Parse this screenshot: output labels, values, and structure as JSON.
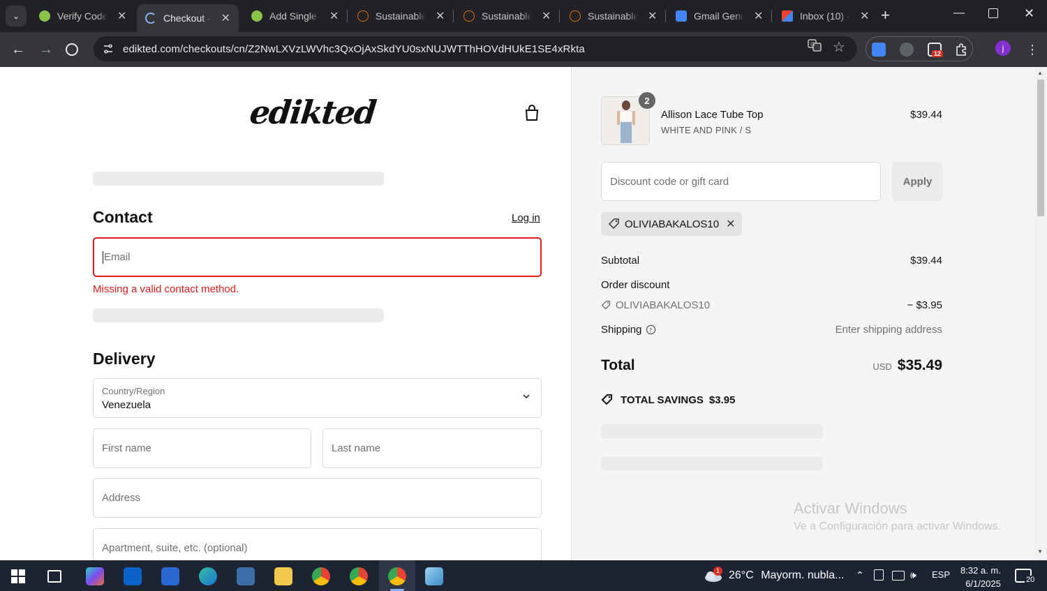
{
  "browser": {
    "tabs": [
      {
        "title": "Verify Codes",
        "active": false,
        "favicon_color": "#8bc34a"
      },
      {
        "title": "Checkout - e",
        "active": true,
        "favicon_color": "#8ab4f8"
      },
      {
        "title": "Add Single-",
        "active": false,
        "favicon_color": "#8bc34a"
      },
      {
        "title": "Sustainable",
        "active": false,
        "favicon_color": "#e8710a"
      },
      {
        "title": "Sustainable",
        "active": false,
        "favicon_color": "#e8710a"
      },
      {
        "title": "Sustainable",
        "active": false,
        "favicon_color": "#e8710a"
      },
      {
        "title": "Gmail Gener",
        "active": false,
        "favicon_color": "#4285f4"
      },
      {
        "title": "Inbox (10) -",
        "active": false,
        "favicon_color": "#ea4335"
      }
    ],
    "url": "edikted.com/checkouts/cn/Z2NwLXVzLWVhc3QxOjAxSkdYU0sxNUJWTThHOVdHUkE1SE4xRkta",
    "extension_badge": "12",
    "profile_initial": "j"
  },
  "checkout": {
    "logo": "edikted",
    "contact": {
      "heading": "Contact",
      "login_link": "Log in",
      "email_placeholder": "Email",
      "error": "Missing a valid contact method."
    },
    "delivery": {
      "heading": "Delivery",
      "country_label": "Country/Region",
      "country_value": "Venezuela",
      "first_name_placeholder": "First name",
      "last_name_placeholder": "Last name",
      "address_placeholder": "Address",
      "apartment_placeholder": "Apartment, suite, etc. (optional)"
    }
  },
  "summary": {
    "item": {
      "quantity": "2",
      "name": "Allison Lace Tube Top",
      "variant": "WHITE AND PINK / S",
      "price": "$39.44"
    },
    "discount_placeholder": "Discount code or gift card",
    "apply_label": "Apply",
    "applied_code": "OLIVIABAKALOS10",
    "subtotal_label": "Subtotal",
    "subtotal_value": "$39.44",
    "order_discount_label": "Order discount",
    "order_discount_code": "OLIVIABAKALOS10",
    "order_discount_value": "− $3.95",
    "shipping_label": "Shipping",
    "shipping_value": "Enter shipping address",
    "total_label": "Total",
    "total_currency": "USD",
    "total_value": "$35.49",
    "savings_label": "TOTAL SAVINGS",
    "savings_value": "$3.95"
  },
  "watermark": {
    "line1": "Activar Windows",
    "line2": "Ve a Configuración para activar Windows."
  },
  "taskbar": {
    "weather_temp": "26°C",
    "weather_desc": "Mayorm. nubla...",
    "weather_alert": "1",
    "language": "ESP",
    "time": "8:32 a. m.",
    "date": "6/1/2025",
    "notifications": "20"
  },
  "colors": {
    "error": "#dd1d1d",
    "summary_bg": "#f5f5f5",
    "taskbar_bg": "#1c2333",
    "chrome_dark": "#202124"
  }
}
